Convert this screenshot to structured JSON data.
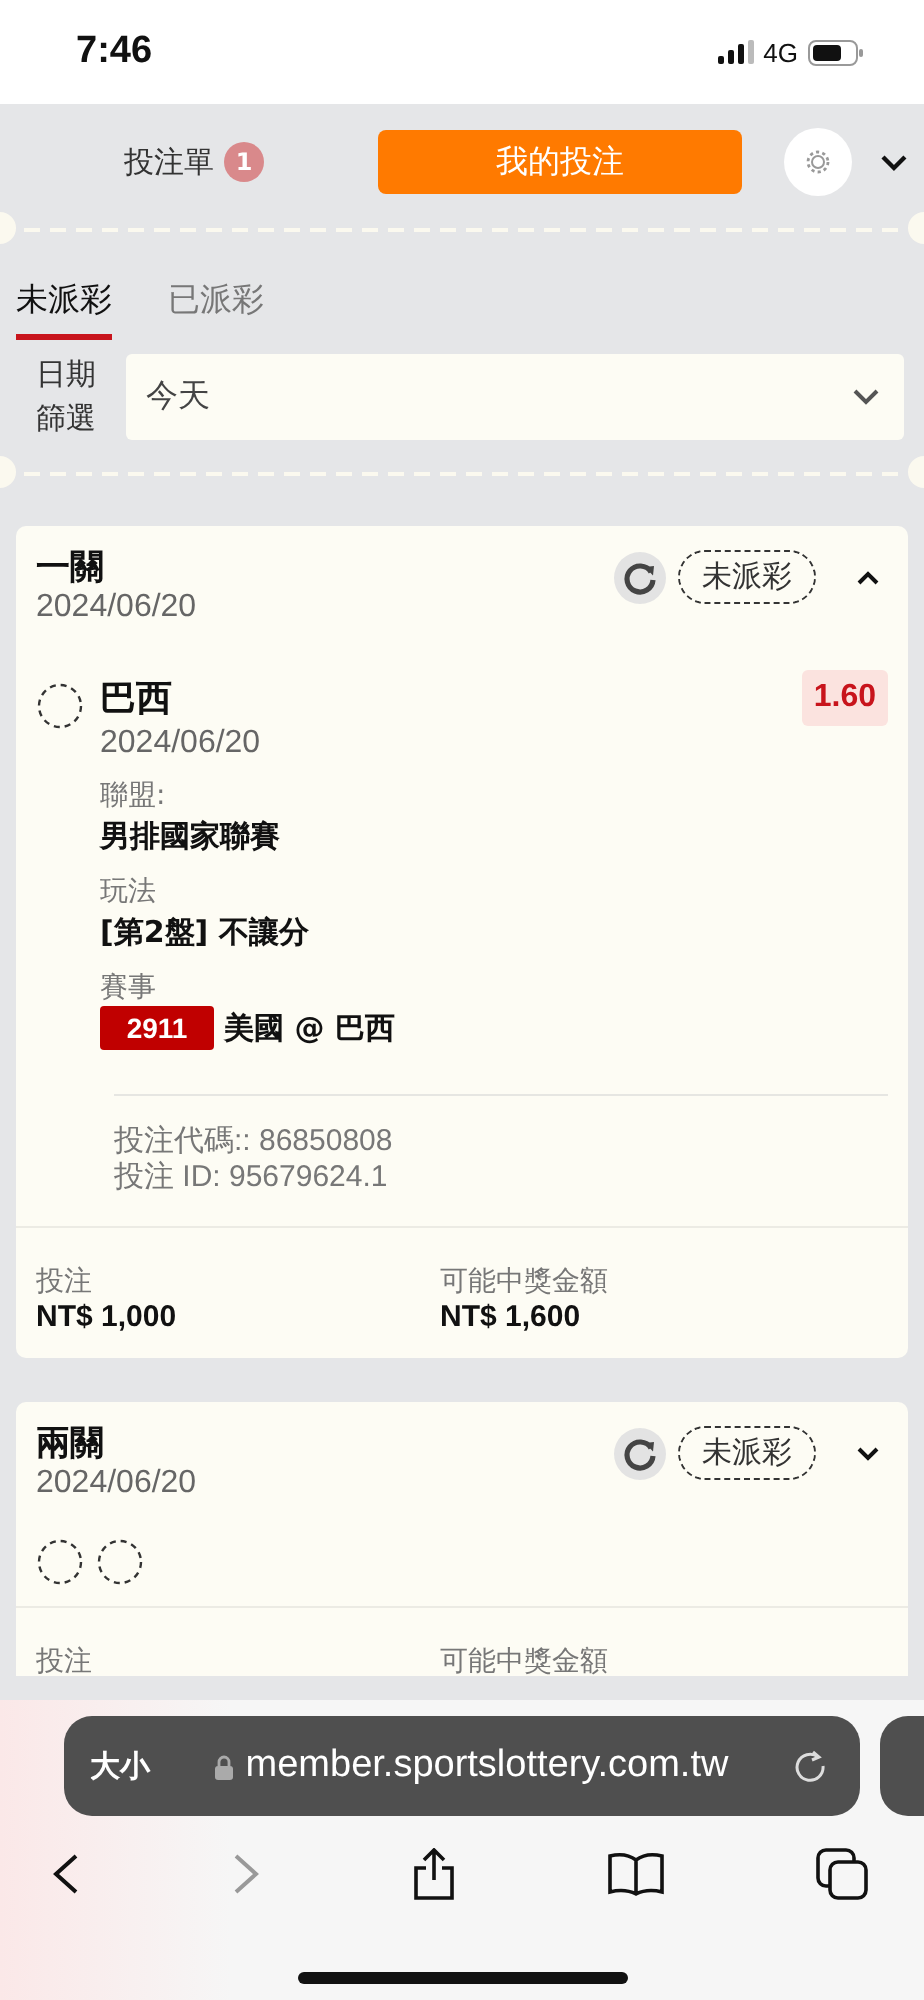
{
  "status_bar": {
    "time": "7:46",
    "network": "4G"
  },
  "header": {
    "bet_slip_label": "投注單",
    "bet_slip_count": "1",
    "my_bets_button": "我的投注"
  },
  "tabs": [
    {
      "label": "未派彩",
      "selected": true
    },
    {
      "label": "已派彩",
      "selected": false
    }
  ],
  "date_filter": {
    "label": "日期篩選",
    "value": "今天"
  },
  "bets": [
    {
      "title": "一關",
      "date": "2024/06/20",
      "status": "未派彩",
      "expanded": true,
      "selections": [
        {
          "team": "巴西",
          "date": "2024/06/20",
          "odds": "1.60",
          "fields": [
            {
              "kind": "text",
              "label": "聯盟:",
              "value": "男排國家聯賽"
            },
            {
              "kind": "text",
              "label": "玩法",
              "value": "[第2盤] 不讓分"
            },
            {
              "kind": "match",
              "label": "賽事",
              "code": "2911",
              "value": "美國 @ 巴西"
            }
          ]
        }
      ],
      "bet_code": "投注代碼:: 86850808",
      "bet_id": "投注 ID: 95679624.1",
      "stake_label": "投注",
      "stake": "NT$ 1,000",
      "payout_label": "可能中獎金額",
      "payout": "NT$ 1,600"
    },
    {
      "title": "兩關",
      "date": "2024/06/20",
      "status": "未派彩",
      "expanded": false,
      "legs": [
        {
          "kind": "pending"
        },
        {
          "kind": "pending"
        }
      ],
      "stake_label": "投注",
      "payout_label": "可能中獎金額"
    }
  ],
  "browser": {
    "text_size": "大小",
    "url": "member.sportslottery.com.tw"
  }
}
